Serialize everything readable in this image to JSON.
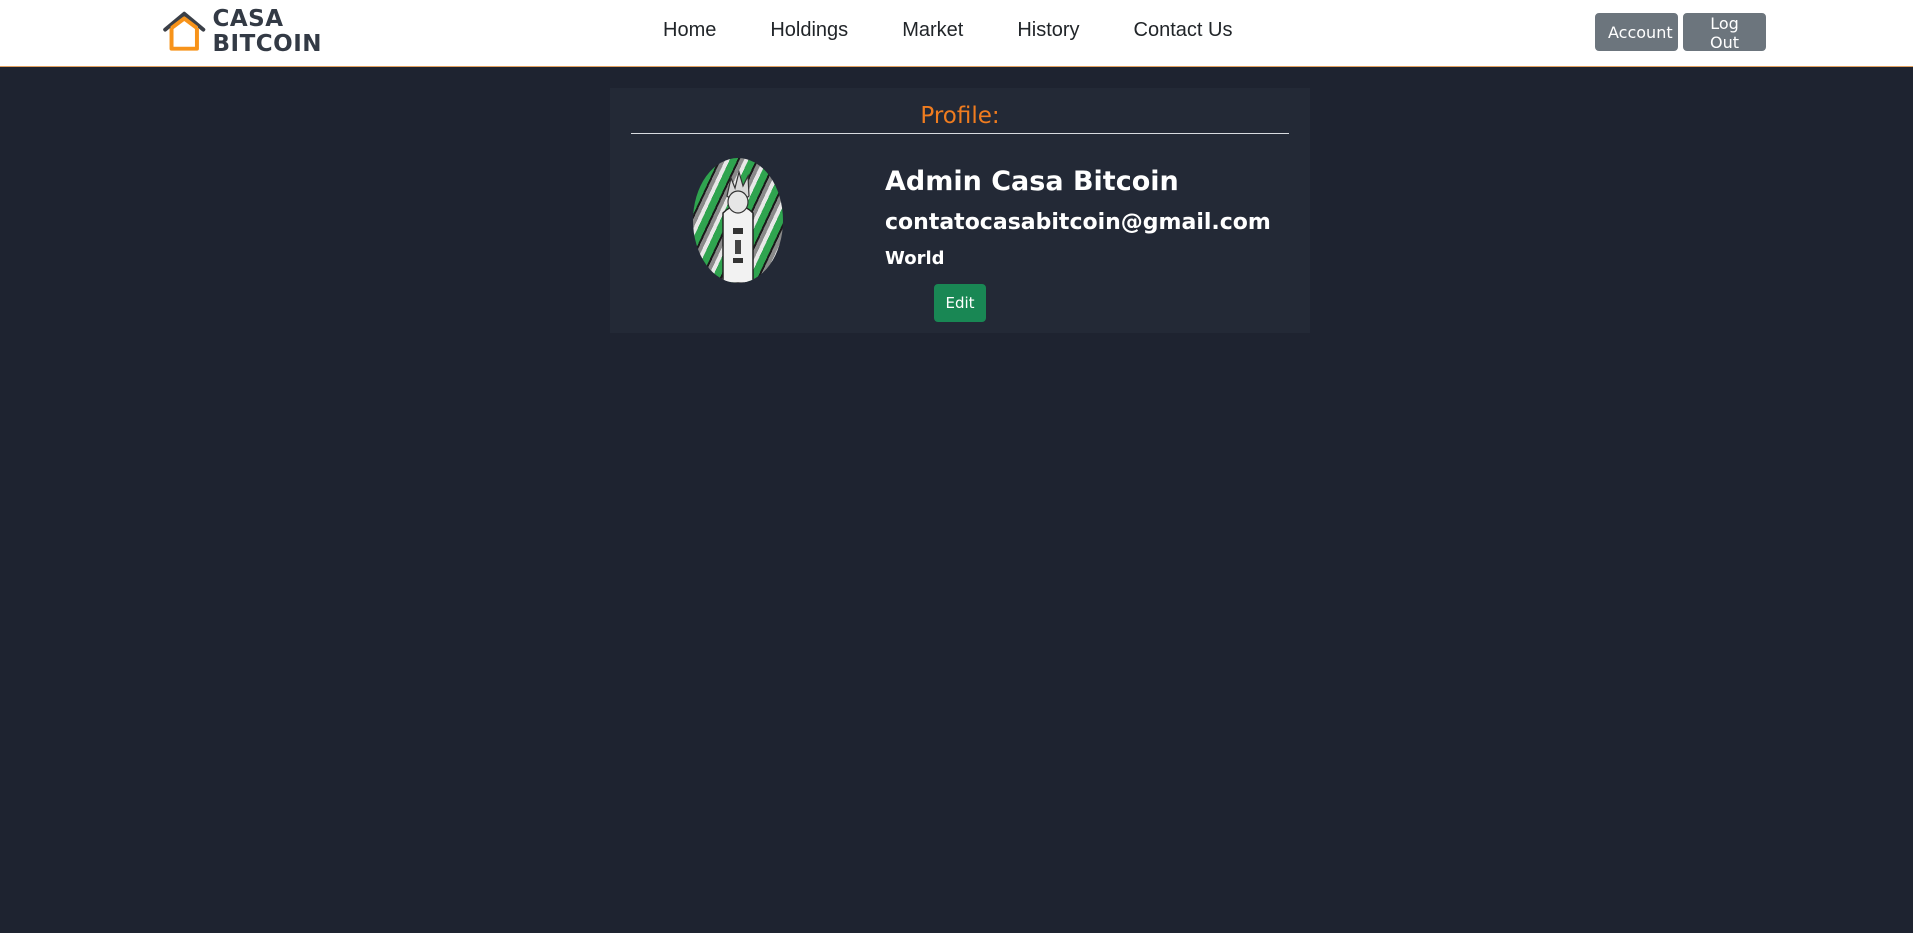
{
  "brand": {
    "line1": "CASA",
    "line2": "BITCOIN",
    "accent_color": "#f7931a"
  },
  "nav": {
    "items": [
      "Home",
      "Holdings",
      "Market",
      "History",
      "Contact Us"
    ]
  },
  "header_actions": {
    "account_label": "Account",
    "logout_label": "Log Out"
  },
  "profile": {
    "title": "Profile:",
    "name": "Admin Casa Bitcoin",
    "email": "contatocasabitcoin@gmail.com",
    "location": "World",
    "edit_label": "Edit",
    "avatar_icon": "profile-avatar"
  },
  "colors": {
    "background": "#1e2330",
    "card": "#232936",
    "title": "#f07c1f",
    "edit_button": "#198754",
    "header_button": "#6c757d"
  }
}
